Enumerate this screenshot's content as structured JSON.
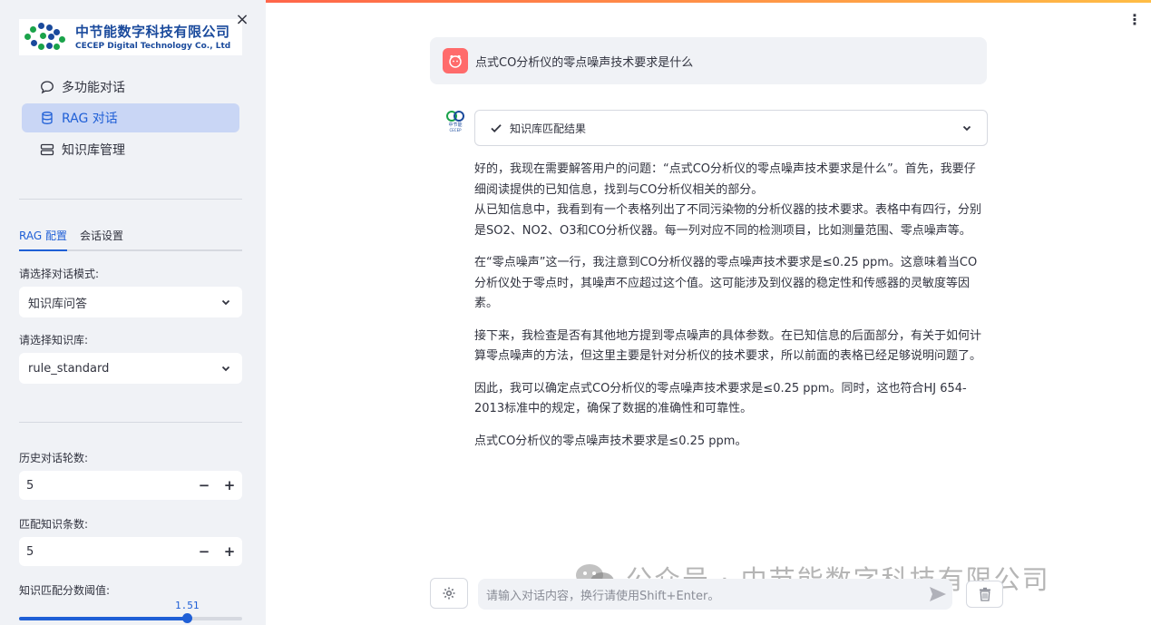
{
  "sidebar": {
    "logo": {
      "cn": "中节能数字科技有限公司",
      "en": "CECEP Digital Technology Co., Ltd"
    },
    "close_icon": "×",
    "nav": [
      {
        "label": "多功能对话",
        "icon": "chat-bubble-icon"
      },
      {
        "label": "RAG 对话",
        "icon": "database-icon",
        "active": true
      },
      {
        "label": "知识库管理",
        "icon": "server-icon"
      }
    ],
    "tabs": [
      {
        "label": "RAG 配置",
        "active": true
      },
      {
        "label": "会话设置"
      }
    ],
    "mode_label": "请选择对话模式:",
    "mode_value": "知识库问答",
    "kb_label": "请选择知识库:",
    "kb_value": "rule_standard",
    "history_label": "历史对话轮数:",
    "history_value": "5",
    "match_label": "匹配知识条数:",
    "match_value": "5",
    "threshold_label": "知识匹配分数阈值:",
    "threshold_value": "1.51",
    "threshold_fraction": 0.755
  },
  "main": {
    "user_question": "点式CO分析仪的零点噪声技术要求是什么",
    "expander_label": "知识库匹配结果",
    "bot_avatar_text": "中节能",
    "bot_avatar_sub": "CECEP",
    "answer": [
      "好的，我现在需要解答用户的问题：“点式CO分析仪的零点噪声技术要求是什么”。首先，我要仔细阅读提供的已知信息，找到与CO分析仪相关的部分。",
      "从已知信息中，我看到有一个表格列出了不同污染物的分析仪器的技术要求。表格中有四行，分别是SO2、NO2、O3和CO分析仪器。每一列对应不同的检测项目，比如测量范围、零点噪声等。",
      "在“零点噪声”这一行，我注意到CO分析仪器的零点噪声技术要求是≤0.25 ppm。这意味着当CO分析仪处于零点时，其噪声不应超过这个值。这可能涉及到仪器的稳定性和传感器的灵敏度等因素。",
      "接下来，我检查是否有其他地方提到零点噪声的具体参数。在已知信息的后面部分，有关于如何计算零点噪声的方法，但这里主要是针对分析仪的技术要求，所以前面的表格已经足够说明问题了。",
      "因此，我可以确定点式CO分析仪的零点噪声技术要求是≤0.25 ppm。同时，这也符合HJ 654-2013标准中的规定，确保了数据的准确性和可靠性。",
      "点式CO分析仪的零点噪声技术要求是≤0.25 ppm。"
    ],
    "input_placeholder": "请输入对话内容，换行请使用Shift+Enter。",
    "watermark": "公众号 · 中节能数字科技有限公司"
  },
  "colors": {
    "accent": "#1f5fd6",
    "sidebar_bg": "#f0f2f6",
    "user_avatar": "#ff6b6b"
  }
}
